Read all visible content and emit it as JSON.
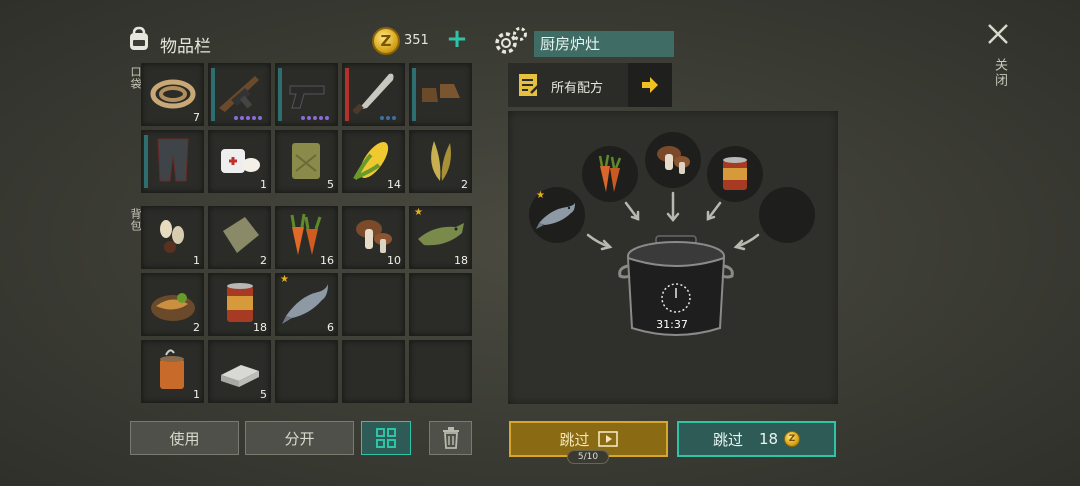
{
  "inventory": {
    "title": "物品栏",
    "coins": "351",
    "coin_symbol": "Z",
    "pocket_label": "口袋",
    "backpack_label": "背包",
    "pocket": [
      {
        "name": "rope",
        "count": "7",
        "bar": ""
      },
      {
        "name": "ak-rifle",
        "count": "",
        "bar": "#2f6e70",
        "dots": 5,
        "dot_color": "#8a6bd8"
      },
      {
        "name": "pistol",
        "count": "",
        "bar": "#2f6e70",
        "dots": 5,
        "dot_color": "#8a6bd8"
      },
      {
        "name": "machete",
        "count": "",
        "bar": "#b0322c",
        "dots": 3,
        "dot_color": "#3d6fa0"
      },
      {
        "name": "boots",
        "count": "",
        "bar": "#2f6e70"
      },
      {
        "name": "armor-pants",
        "count": "",
        "bar": "#2f6e70"
      },
      {
        "name": "bandage-medkit",
        "count": "1"
      },
      {
        "name": "jerrycan",
        "count": "5"
      },
      {
        "name": "corn",
        "count": "14"
      },
      {
        "name": "leaves",
        "count": "2"
      }
    ],
    "backpack": [
      {
        "name": "seeds",
        "count": "1"
      },
      {
        "name": "cloth",
        "count": "2"
      },
      {
        "name": "carrots",
        "count": "16"
      },
      {
        "name": "mushrooms",
        "count": "10"
      },
      {
        "name": "pike-fish",
        "count": "18",
        "star": true
      },
      {
        "name": "fish-dish",
        "count": "2"
      },
      {
        "name": "canned-food",
        "count": "18"
      },
      {
        "name": "salmon",
        "count": "6",
        "star": true
      },
      {
        "name": "empty",
        "count": ""
      },
      {
        "name": "empty",
        "count": ""
      },
      {
        "name": "stew-can",
        "count": "1"
      },
      {
        "name": "metal-bars",
        "count": "5"
      },
      {
        "name": "empty",
        "count": ""
      },
      {
        "name": "empty",
        "count": ""
      },
      {
        "name": "empty",
        "count": ""
      }
    ],
    "actions": {
      "use": "使用",
      "split": "分开"
    }
  },
  "station": {
    "name": "厨房炉灶",
    "recipes_label": "所有配方",
    "timer": "31:37",
    "ingredients": [
      "salmon",
      "carrots",
      "mushrooms",
      "canned-food",
      "empty"
    ]
  },
  "skip": {
    "ad_label": "跳过",
    "ad_counter": "5/10",
    "coin_label": "跳过",
    "coin_cost": "18"
  },
  "close": {
    "label": "关闭"
  },
  "colors": {
    "teal_accent": "#2ec4a8",
    "gold_accent": "#d6a72a"
  }
}
